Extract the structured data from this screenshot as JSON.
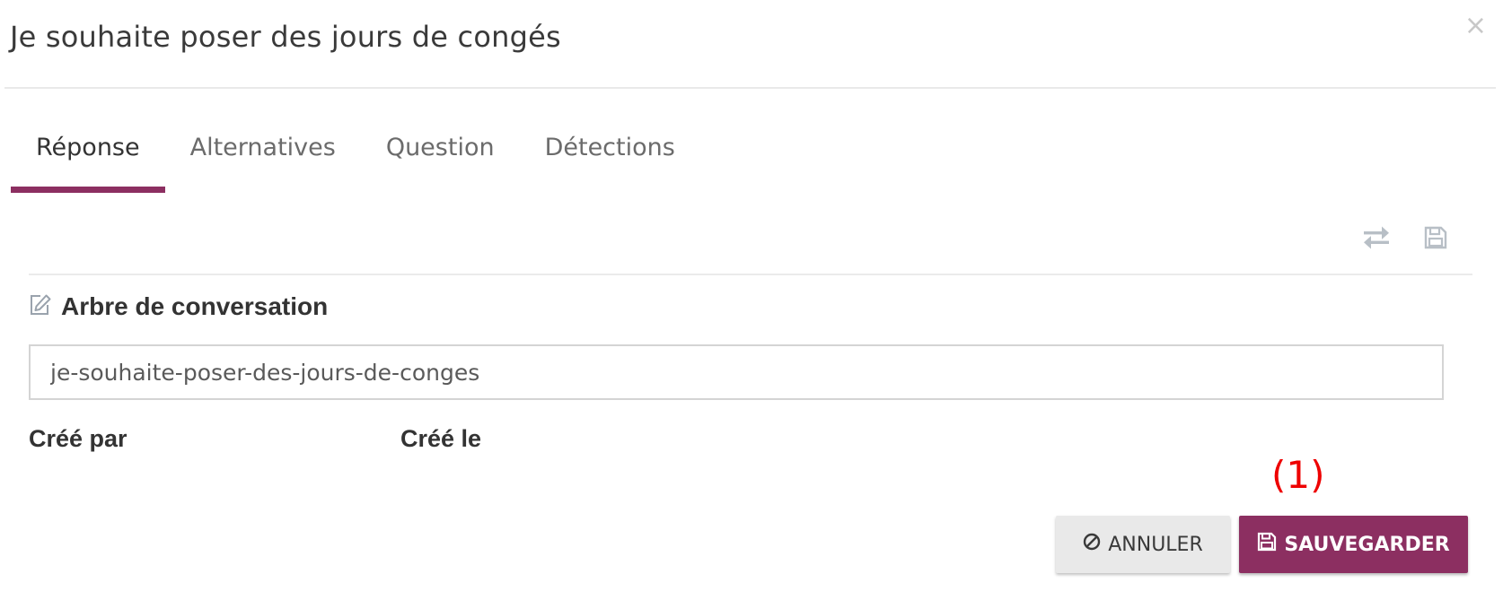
{
  "modal": {
    "title": "Je souhaite poser des jours de congés",
    "close_symbol": "×"
  },
  "tabs": [
    {
      "label": "Réponse",
      "active": true
    },
    {
      "label": "Alternatives",
      "active": false
    },
    {
      "label": "Question",
      "active": false
    },
    {
      "label": "Détections",
      "active": false
    }
  ],
  "toolbar": {
    "icons": [
      "swap-arrows-icon",
      "floppy-disk-icon"
    ]
  },
  "section": {
    "icon": "edit-icon",
    "title": "Arbre de conversation",
    "slug_value": "je-souhaite-poser-des-jours-de-conges"
  },
  "meta": {
    "created_by_label": "Créé par",
    "created_on_label": "Créé le"
  },
  "annotation": {
    "marker": "(1)",
    "color": "#ee0000"
  },
  "actions": {
    "cancel_icon": "ban-icon",
    "cancel_label": "ANNULER",
    "save_icon": "floppy-disk-icon",
    "save_label": "SAUVEGARDER"
  },
  "colors": {
    "accent": "#8c2f61",
    "cancel_bg": "#e9e9e9",
    "icon_muted": "#b8bfc6"
  }
}
